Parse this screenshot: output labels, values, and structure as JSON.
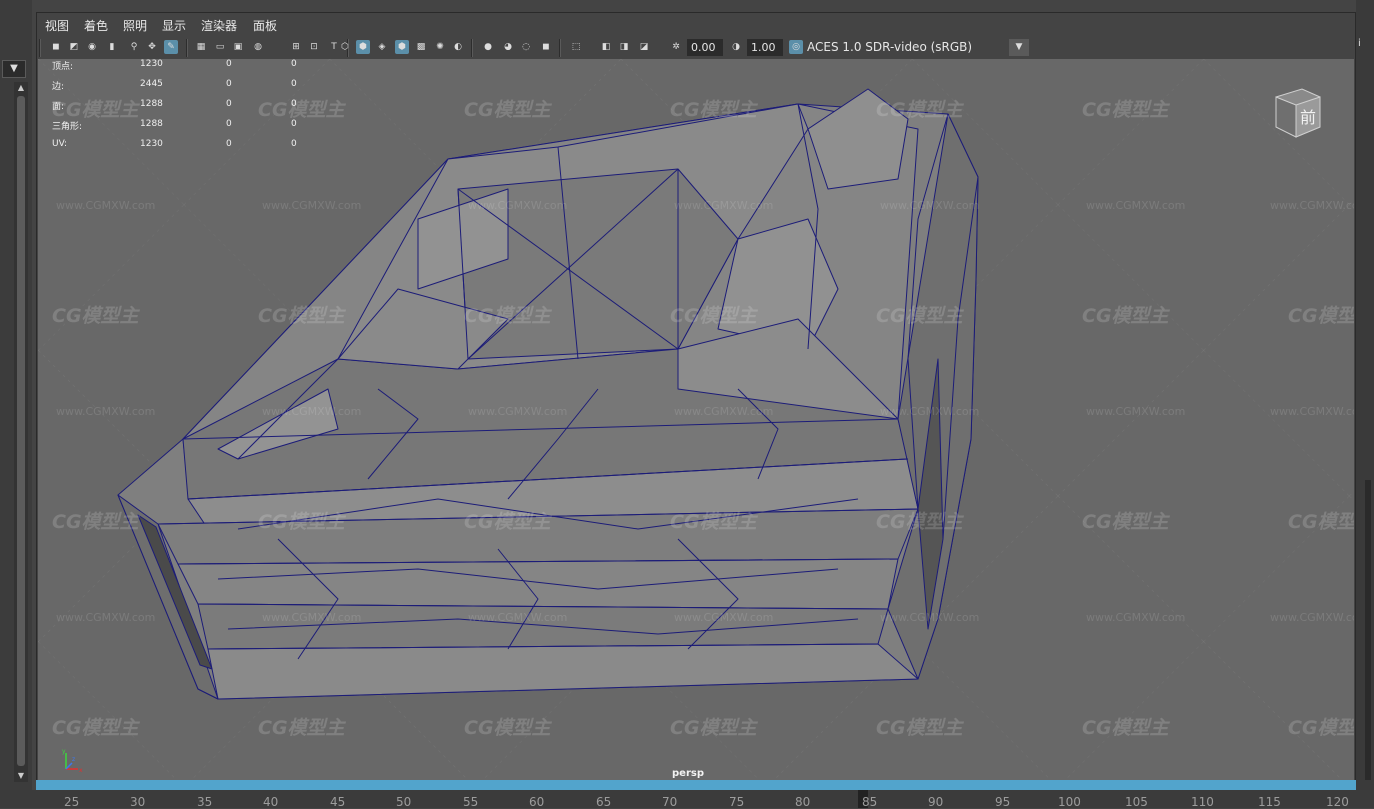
{
  "menu": [
    "视图",
    "着色",
    "照明",
    "显示",
    "渲染器",
    "面板"
  ],
  "toolbar": {
    "field1": "0.00",
    "field2": "1.00",
    "colorspace": "ACES 1.0 SDR-video (sRGB)"
  },
  "hud": {
    "rows": [
      {
        "label": "顶点:",
        "v1": "1230",
        "v2": "0",
        "v3": "0"
      },
      {
        "label": "边:",
        "v1": "2445",
        "v2": "0",
        "v3": "0"
      },
      {
        "label": "面:",
        "v1": "1288",
        "v2": "0",
        "v3": "0"
      },
      {
        "label": "三角形:",
        "v1": "1288",
        "v2": "0",
        "v3": "0"
      },
      {
        "label": "UV:",
        "v1": "1230",
        "v2": "0",
        "v3": "0"
      }
    ]
  },
  "viewcube_label": "前",
  "camera_label": "persp",
  "watermark": {
    "logo": "CG模型主",
    "url": "www.CGMXW.com"
  },
  "ruler": [
    "25",
    "30",
    "35",
    "40",
    "45",
    "50",
    "55",
    "60",
    "65",
    "70",
    "75",
    "80",
    "85",
    "90",
    "95",
    "100",
    "105",
    "110",
    "115",
    "120"
  ],
  "colors": {
    "accent": "#52a4cc",
    "wire": "#1c1c78",
    "mesh": "#7d7d7d"
  }
}
